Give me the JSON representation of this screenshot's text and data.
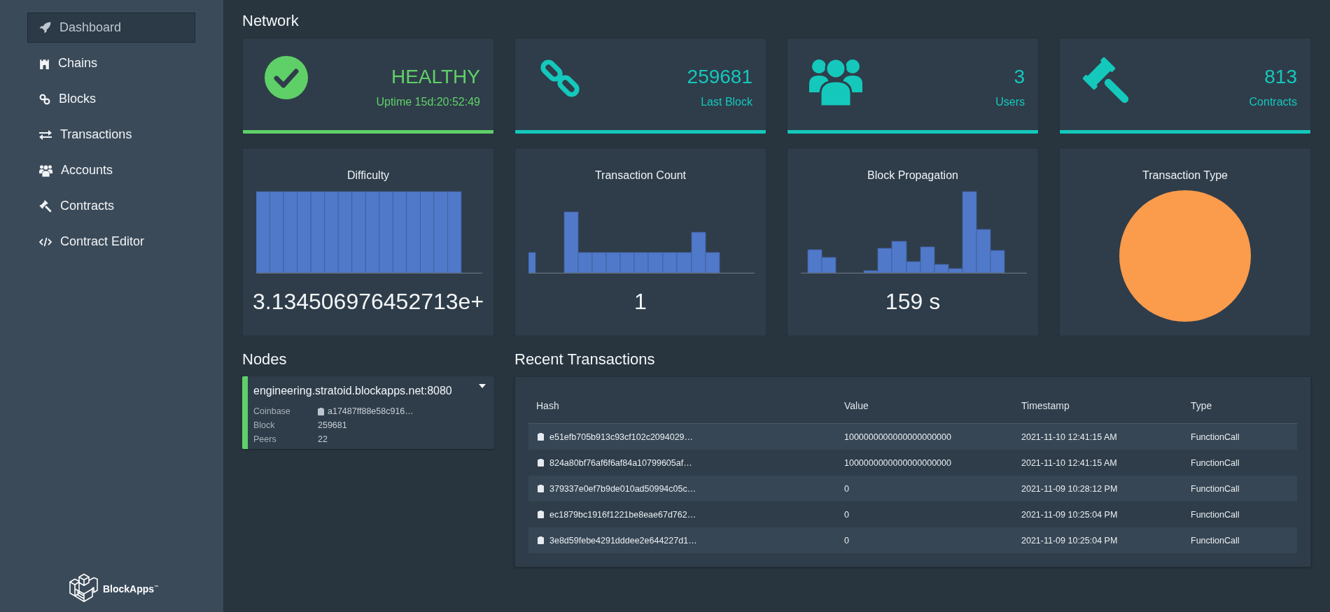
{
  "sidebar": {
    "items": [
      {
        "label": "Dashboard",
        "selected": true
      },
      {
        "label": "Chains",
        "selected": false
      },
      {
        "label": "Blocks",
        "selected": false
      },
      {
        "label": "Transactions",
        "selected": false
      },
      {
        "label": "Accounts",
        "selected": false
      },
      {
        "label": "Contracts",
        "selected": false
      },
      {
        "label": "Contract Editor",
        "selected": false
      }
    ],
    "logo_text": "BlockApps$^{™}$"
  },
  "network": {
    "title": "Network",
    "stats": [
      {
        "value": "HEALTHY",
        "label": "Uptime 15d:20:52:49",
        "color": "#5fd068"
      },
      {
        "value": "259681",
        "label": "Last Block",
        "color": "#14c8bc"
      },
      {
        "value": "3",
        "label": "Users",
        "color": "#14c8bc"
      },
      {
        "value": "813",
        "label": "Contracts",
        "color": "#14c8bc"
      }
    ],
    "charts": [
      {
        "kind": "histogram",
        "title": "Difficulty",
        "value": "3.134506976452713e+"
      },
      {
        "kind": "histogram",
        "title": "Transaction Count",
        "value": "1"
      },
      {
        "kind": "histogram",
        "title": "Block Propagation",
        "value": "159 s"
      },
      {
        "kind": "pie",
        "title": "Transaction Type"
      }
    ]
  },
  "nodes": {
    "title": "Nodes",
    "items": [
      {
        "host": "engineering.stratoid.blockapps.net:8080",
        "color": "#5fd068",
        "fields": [
          {
            "kind": "hash",
            "label": "Coinbase",
            "value": "a17487ff88e58c916…"
          },
          {
            "kind": "text",
            "label": "Block",
            "value": "259681"
          },
          {
            "kind": "text",
            "label": "Peers",
            "value": "22"
          }
        ]
      }
    ]
  },
  "recent_transactions": {
    "title": "Recent Transactions",
    "table": {
      "columns": [
        "Hash",
        "Value",
        "Timestamp",
        "Type"
      ],
      "rows": [
        {
          "hash": "e51efb705b913c93cf102c2094029…",
          "value": "1000000000000000000000",
          "timestamp": "2021-11-10 12:41:15 AM",
          "type": "FunctionCall"
        },
        {
          "hash": "824a80bf76af6f6af84a10799605af…",
          "value": "1000000000000000000000",
          "timestamp": "2021-11-10 12:41:15 AM",
          "type": "FunctionCall"
        },
        {
          "hash": "379337e0ef7b9de010ad50994c05c…",
          "value": "0",
          "timestamp": "2021-11-09 10:28:12 PM",
          "type": "FunctionCall"
        },
        {
          "hash": "ec1879bc1916f1221be8eae67d762…",
          "value": "0",
          "timestamp": "2021-11-09 10:25:04 PM",
          "type": "FunctionCall"
        },
        {
          "hash": "3e8d59febe4291dddee2e644227d1…",
          "value": "0",
          "timestamp": "2021-11-09 10:25:04 PM",
          "type": "FunctionCall"
        }
      ]
    }
  }
}
